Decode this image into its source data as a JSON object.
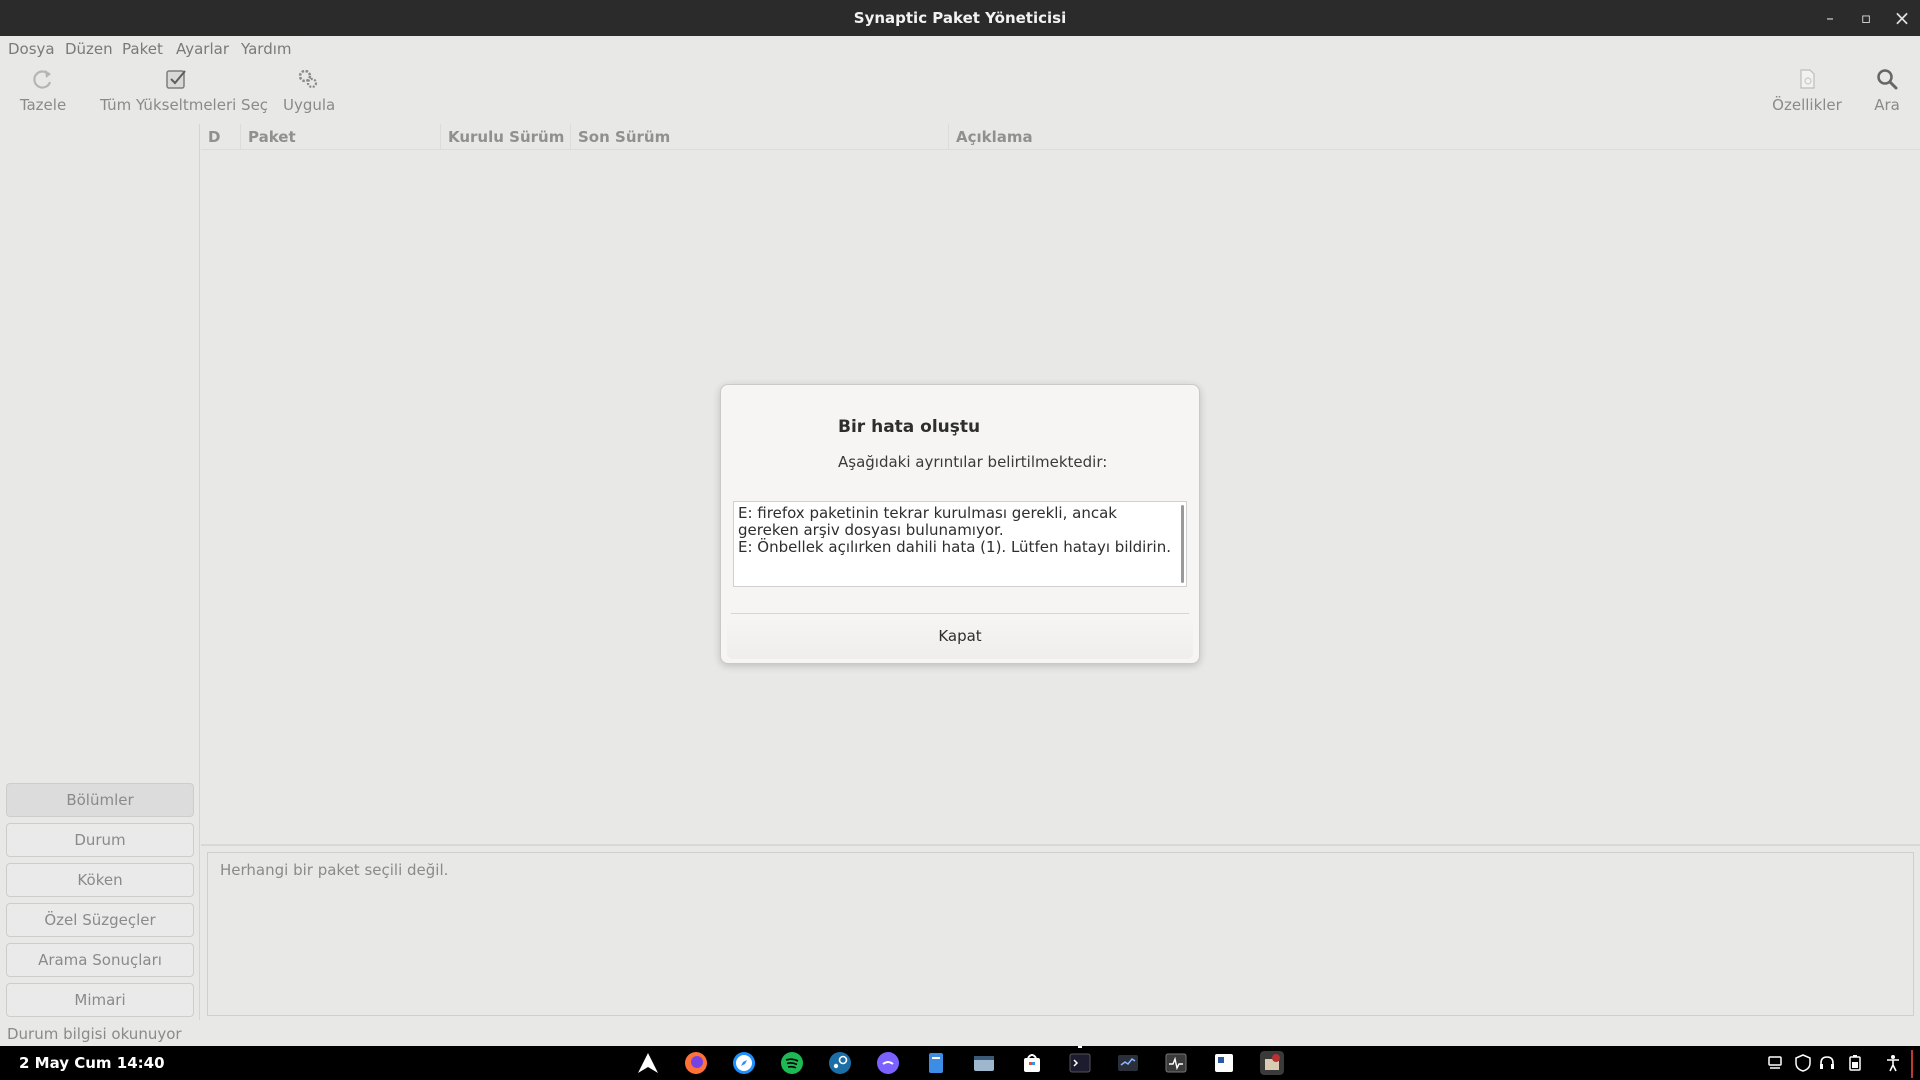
{
  "window": {
    "title": "Synaptic Paket Yöneticisi",
    "minimize_icon": "–",
    "maximize_icon": "▫",
    "close_icon": "×"
  },
  "menu": [
    "Dosya",
    "Düzen",
    "Paket",
    "Ayarlar",
    "Yardım"
  ],
  "toolbar": {
    "reload": "Tazele",
    "mark_upgrades": "Tüm Yükseltmeleri Seç",
    "apply": "Uygula",
    "properties": "Özellikler",
    "search": "Ara"
  },
  "list": {
    "columns": [
      "D",
      "Paket",
      "Kurulu Sürüm",
      "Son Sürüm",
      "Açıklama"
    ]
  },
  "sidebar": {
    "filters": [
      "Bölümler",
      "Durum",
      "Köken",
      "Özel Süzgeçler",
      "Arama Sonuçları",
      "Mimari"
    ],
    "active": "Bölümler"
  },
  "detail": {
    "text": "Herhangi bir paket seçili değil."
  },
  "status": {
    "text": "Durum bilgisi okunuyor"
  },
  "dialog": {
    "title": "Bir hata oluştu",
    "subtitle": "Aşağıdaki ayrıntılar belirtilmektedir:",
    "lines": [
      "E: firefox paketinin tekrar kurulması gerekli, ancak gereken arşiv dosyası bulunamıyor.",
      "E: Önbellek açılırken dahili hata (1). Lütfen hatayı bildirin."
    ],
    "close_button": "Kapat"
  },
  "taskbar": {
    "clock": "2 May Cum  14:40",
    "apps": [
      "arch-icon",
      "firefox-icon",
      "safari-icon",
      "spotify-icon",
      "steam-icon",
      "discord-icon",
      "files-icon",
      "archive-icon",
      "store-icon",
      "terminal-icon",
      "monitor-icon",
      "activity-icon",
      "notes-icon",
      "synaptic-icon"
    ],
    "tray": [
      "network-icon",
      "shield-icon",
      "headset-icon",
      "battery-icon",
      "accessibility-icon"
    ]
  },
  "colors": {
    "titlebar": "#2b2b2b",
    "background": "#e8e8e7",
    "dialog": "#f6f5f4",
    "taskbar": "#000000"
  }
}
